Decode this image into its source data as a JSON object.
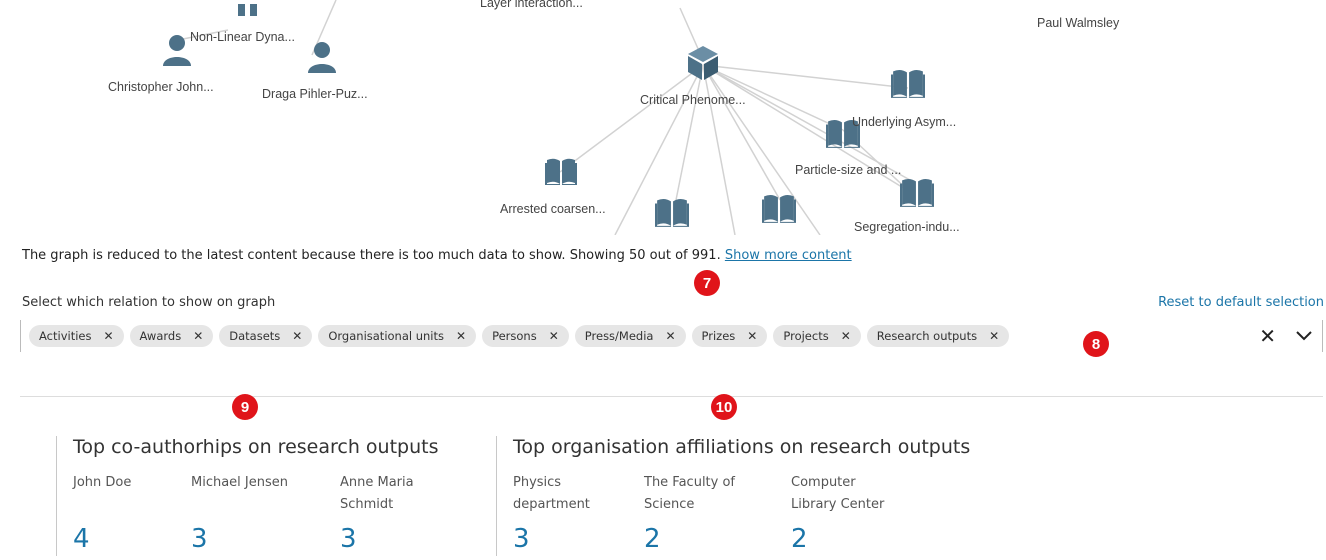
{
  "graph": {
    "nodes": {
      "non_linear": "Non-Linear Dyna...",
      "layer_interaction": "Layer interaction...",
      "paul": "Paul Walmsley",
      "christopher": "Christopher John...",
      "draga": "Draga Pihler-Puz...",
      "critical": "Critical Phenome...",
      "underlying": "Underlying Asym...",
      "particle": "Particle-size and ...",
      "arrested": "Arrested coarsen...",
      "segregation": "Segregation-indu..."
    },
    "colors": {
      "node": "#4d7188",
      "edge": "#d2d2d2"
    }
  },
  "notice": {
    "text": "The graph is reduced to the latest content because there is too much data to show. Showing 50 out of 991. ",
    "link": "Show more content"
  },
  "badges": {
    "b7": "7",
    "b8": "8",
    "b9": "9",
    "b10": "10"
  },
  "relations": {
    "label": "Select which relation to show on graph",
    "reset": "Reset to default selection",
    "chips": [
      "Activities",
      "Awards",
      "Datasets",
      "Organisational units",
      "Persons",
      "Press/Media",
      "Prizes",
      "Projects",
      "Research outputs"
    ],
    "clear_icon": "close-icon",
    "expand_icon": "chevron-down-icon"
  },
  "coauthors": {
    "title": "Top co-authorhips on research outputs",
    "items": [
      {
        "name": "John Doe",
        "count": "4"
      },
      {
        "name": "Michael Jensen",
        "count": "3"
      },
      {
        "name": "Anne Maria Schmidt",
        "count": "3"
      }
    ]
  },
  "organisations": {
    "title": "Top organisation affiliations on research outputs",
    "items": [
      {
        "name": "Physics department",
        "count": "3"
      },
      {
        "name": "The Faculty of Science",
        "count": "2"
      },
      {
        "name": "Computer Library Center",
        "count": "2"
      }
    ]
  },
  "accent_color": "#1b75a8",
  "badge_color": "#e0141a"
}
